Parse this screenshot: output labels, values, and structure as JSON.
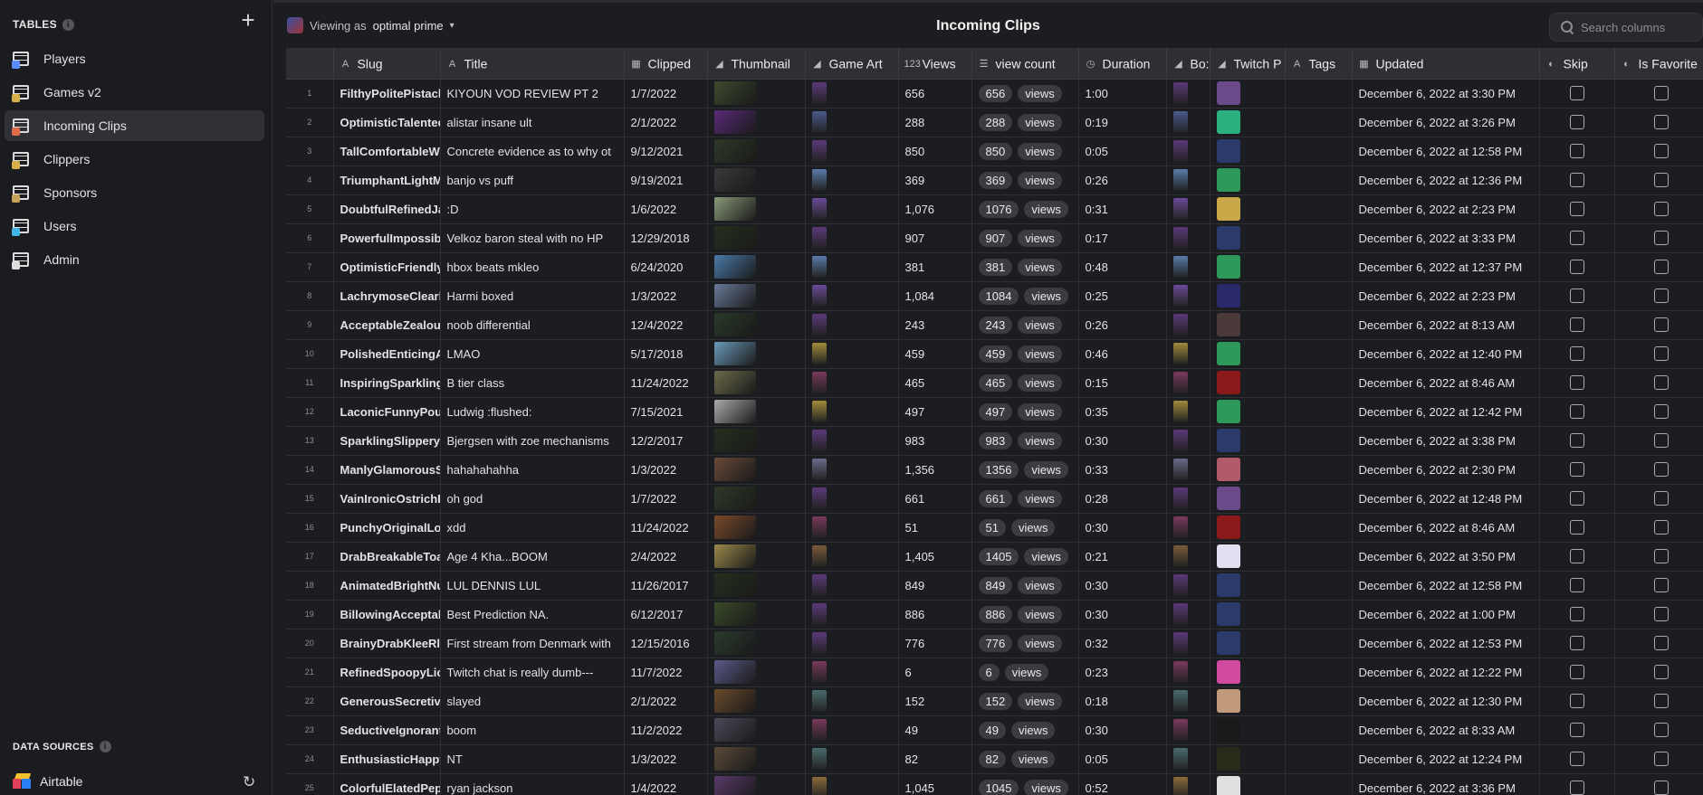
{
  "sidebar": {
    "section_title": "TABLES",
    "items": [
      {
        "label": "Players",
        "dot": "#5b8cff"
      },
      {
        "label": "Games v2",
        "dot": "#d7b04a"
      },
      {
        "label": "Incoming Clips",
        "dot": "#e06c4a"
      },
      {
        "label": "Clippers",
        "dot": "#d7b04a"
      },
      {
        "label": "Sponsors",
        "dot": "#c7a25b"
      },
      {
        "label": "Users",
        "dot": "#41b6e6"
      },
      {
        "label": "Admin",
        "dot": "#dddddd"
      }
    ],
    "active_index": 2,
    "data_sources_title": "DATA SOURCES",
    "data_source": "Airtable"
  },
  "topbar": {
    "viewing_prefix": "Viewing as",
    "viewing_user": "optimal prime",
    "title": "Incoming Clips",
    "search_placeholder": "Search columns"
  },
  "columns": [
    {
      "key": "num",
      "label": "",
      "icon": ""
    },
    {
      "key": "slug",
      "label": "Slug",
      "icon": "A"
    },
    {
      "key": "title",
      "label": "Title",
      "icon": "A"
    },
    {
      "key": "clipped",
      "label": "Clipped",
      "icon": "▦"
    },
    {
      "key": "thumb",
      "label": "Thumbnail",
      "icon": "◢"
    },
    {
      "key": "art",
      "label": "Game Art",
      "icon": "◢"
    },
    {
      "key": "views",
      "label": "Views",
      "icon": "123"
    },
    {
      "key": "vc",
      "label": "view count",
      "icon": "☰"
    },
    {
      "key": "dur",
      "label": "Duration",
      "icon": "◷"
    },
    {
      "key": "box",
      "label": "Bo:",
      "icon": "◢"
    },
    {
      "key": "twitch",
      "label": "Twitch P",
      "icon": "◢"
    },
    {
      "key": "tags",
      "label": "Tags",
      "icon": "A"
    },
    {
      "key": "updated",
      "label": "Updated",
      "icon": "▦"
    },
    {
      "key": "skip",
      "label": "Skip",
      "icon": "◐"
    },
    {
      "key": "fav",
      "label": "Is Favorite",
      "icon": "◐"
    }
  ],
  "views_unit": "views",
  "rows": [
    {
      "n": "1",
      "slug": "FilthyPolitePistach",
      "title": "KIYOUN VOD REVIEW PT 2",
      "clipped": "1/7/2022",
      "views": "656",
      "vc": "656",
      "dur": "1:00",
      "updated": "December 6, 2022 at 3:30 PM",
      "thumb": "#3d4a2e",
      "art": "#5a3a7a",
      "twitch": "#6b4a8a"
    },
    {
      "n": "2",
      "slug": "OptimisticTalented",
      "title": "alistar insane ult",
      "clipped": "2/1/2022",
      "views": "288",
      "vc": "288",
      "dur": "0:19",
      "updated": "December 6, 2022 at 3:26 PM",
      "thumb": "#5a2a7a",
      "art": "#4a5a8a",
      "twitch": "#2bb080"
    },
    {
      "n": "3",
      "slug": "TallComfortableW",
      "title": "Concrete evidence as to why ot",
      "clipped": "9/12/2021",
      "views": "850",
      "vc": "850",
      "dur": "0:05",
      "updated": "December 6, 2022 at 12:58 PM",
      "thumb": "#2e3a28",
      "art": "#5a3a7a",
      "twitch": "#2a3a6a"
    },
    {
      "n": "4",
      "slug": "TriumphantLightM",
      "title": "banjo vs puff",
      "clipped": "9/19/2021",
      "views": "369",
      "vc": "369",
      "dur": "0:26",
      "updated": "December 6, 2022 at 12:36 PM",
      "thumb": "#3a3a3a",
      "art": "#5a7aaa",
      "twitch": "#2e9a5a"
    },
    {
      "n": "5",
      "slug": "DoubtfulRefinedJa",
      "title": ":D",
      "clipped": "1/6/2022",
      "views": "1,076",
      "vc": "1076",
      "dur": "0:31",
      "updated": "December 6, 2022 at 2:23 PM",
      "thumb": "#8a9a7a",
      "art": "#6a4a9a",
      "twitch": "#c9a84a"
    },
    {
      "n": "6",
      "slug": "PowerfulImpossib",
      "title": "Velkoz baron steal with no HP",
      "clipped": "12/29/2018",
      "views": "907",
      "vc": "907",
      "dur": "0:17",
      "updated": "December 6, 2022 at 3:33 PM",
      "thumb": "#26301e",
      "art": "#5a3a7a",
      "twitch": "#2a3a6a"
    },
    {
      "n": "7",
      "slug": "OptimisticFriendly",
      "title": "hbox beats mkleo",
      "clipped": "6/24/2020",
      "views": "381",
      "vc": "381",
      "dur": "0:48",
      "updated": "December 6, 2022 at 12:37 PM",
      "thumb": "#4a7aaa",
      "art": "#5a7aaa",
      "twitch": "#2e9a5a"
    },
    {
      "n": "8",
      "slug": "LachrymoseClearl",
      "title": "Harmi boxed",
      "clipped": "1/3/2022",
      "views": "1,084",
      "vc": "1084",
      "dur": "0:25",
      "updated": "December 6, 2022 at 2:23 PM",
      "thumb": "#6a7a9a",
      "art": "#6a4a9a",
      "twitch": "#2a2a6a"
    },
    {
      "n": "9",
      "slug": "AcceptableZealou",
      "title": "noob differential",
      "clipped": "12/4/2022",
      "views": "243",
      "vc": "243",
      "dur": "0:26",
      "updated": "December 6, 2022 at 8:13 AM",
      "thumb": "#2a3a2a",
      "art": "#5a3a7a",
      "twitch": "#4a3a3a"
    },
    {
      "n": "10",
      "slug": "PolishedEnticingA",
      "title": "LMAO",
      "clipped": "5/17/2018",
      "views": "459",
      "vc": "459",
      "dur": "0:46",
      "updated": "December 6, 2022 at 12:40 PM",
      "thumb": "#6a9aba",
      "art": "#a08a3a",
      "twitch": "#2e9a5a"
    },
    {
      "n": "11",
      "slug": "InspiringSparkling",
      "title": "B tier class",
      "clipped": "11/24/2022",
      "views": "465",
      "vc": "465",
      "dur": "0:15",
      "updated": "December 6, 2022 at 8:46 AM",
      "thumb": "#6a6a4a",
      "art": "#7a3a5a",
      "twitch": "#8a1a1a"
    },
    {
      "n": "12",
      "slug": "LaconicFunnyPoul",
      "title": "Ludwig :flushed:",
      "clipped": "7/15/2021",
      "views": "497",
      "vc": "497",
      "dur": "0:35",
      "updated": "December 6, 2022 at 12:42 PM",
      "thumb": "#aaaaaa",
      "art": "#a08a3a",
      "twitch": "#2e9a5a"
    },
    {
      "n": "13",
      "slug": "SparklingSlipperyI",
      "title": "Bjergsen with zoe mechanisms",
      "clipped": "12/2/2017",
      "views": "983",
      "vc": "983",
      "dur": "0:30",
      "updated": "December 6, 2022 at 3:38 PM",
      "thumb": "#26301e",
      "art": "#5a3a7a",
      "twitch": "#2a3a6a"
    },
    {
      "n": "14",
      "slug": "ManlyGlamorousS",
      "title": "hahahahahha",
      "clipped": "1/3/2022",
      "views": "1,356",
      "vc": "1356",
      "dur": "0:33",
      "updated": "December 6, 2022 at 2:30 PM",
      "thumb": "#6a4a3a",
      "art": "#6a6a8a",
      "twitch": "#b05a6a"
    },
    {
      "n": "15",
      "slug": "VainIronicOstrichE",
      "title": "oh god",
      "clipped": "1/7/2022",
      "views": "661",
      "vc": "661",
      "dur": "0:28",
      "updated": "December 6, 2022 at 12:48 PM",
      "thumb": "#2e3a28",
      "art": "#5a3a7a",
      "twitch": "#6b4a8a"
    },
    {
      "n": "16",
      "slug": "PunchyOriginalLoi",
      "title": "xdd",
      "clipped": "11/24/2022",
      "views": "51",
      "vc": "51",
      "dur": "0:30",
      "updated": "December 6, 2022 at 8:46 AM",
      "thumb": "#7a4a2a",
      "art": "#7a3a5a",
      "twitch": "#8a1a1a"
    },
    {
      "n": "17",
      "slug": "DrabBreakableToa",
      "title": "Age 4 Kha...BOOM",
      "clipped": "2/4/2022",
      "views": "1,405",
      "vc": "1405",
      "dur": "0:21",
      "updated": "December 6, 2022 at 3:50 PM",
      "thumb": "#9a8a4a",
      "art": "#7a5a3a",
      "twitch": "#e0e0f0"
    },
    {
      "n": "18",
      "slug": "AnimatedBrightNu",
      "title": "LUL DENNIS LUL",
      "clipped": "11/26/2017",
      "views": "849",
      "vc": "849",
      "dur": "0:30",
      "updated": "December 6, 2022 at 12:58 PM",
      "thumb": "#26301e",
      "art": "#5a3a7a",
      "twitch": "#2a3a6a"
    },
    {
      "n": "19",
      "slug": "BillowingAcceptab",
      "title": "Best Prediction NA.",
      "clipped": "6/12/2017",
      "views": "886",
      "vc": "886",
      "dur": "0:30",
      "updated": "December 6, 2022 at 1:00 PM",
      "thumb": "#3a4a2a",
      "art": "#5a3a7a",
      "twitch": "#2a3a6a"
    },
    {
      "n": "20",
      "slug": "BrainyDrabKleeRly",
      "title": "First stream from Denmark with",
      "clipped": "12/15/2016",
      "views": "776",
      "vc": "776",
      "dur": "0:32",
      "updated": "December 6, 2022 at 12:53 PM",
      "thumb": "#2a3a2e",
      "art": "#5a3a7a",
      "twitch": "#2a3a6a"
    },
    {
      "n": "21",
      "slug": "RefinedSpoopyLio",
      "title": "Twitch chat is really dumb---",
      "clipped": "11/7/2022",
      "views": "6",
      "vc": "6",
      "dur": "0:23",
      "updated": "December 6, 2022 at 12:22 PM",
      "thumb": "#5a5a8a",
      "art": "#7a3a5a",
      "twitch": "#d04aa0"
    },
    {
      "n": "22",
      "slug": "GenerousSecretiv",
      "title": "slayed",
      "clipped": "2/1/2022",
      "views": "152",
      "vc": "152",
      "dur": "0:18",
      "updated": "December 6, 2022 at 12:30 PM",
      "thumb": "#6a4a2a",
      "art": "#4a6a6a",
      "twitch": "#c09a7a"
    },
    {
      "n": "23",
      "slug": "SeductiveIgnorant",
      "title": "boom",
      "clipped": "11/2/2022",
      "views": "49",
      "vc": "49",
      "dur": "0:30",
      "updated": "December 6, 2022 at 8:33 AM",
      "thumb": "#4a4a5a",
      "art": "#7a3a5a",
      "twitch": "#1a1a1a"
    },
    {
      "n": "24",
      "slug": "EnthusiasticHappy",
      "title": "NT",
      "clipped": "1/3/2022",
      "views": "82",
      "vc": "82",
      "dur": "0:05",
      "updated": "December 6, 2022 at 12:24 PM",
      "thumb": "#5a4a3a",
      "art": "#4a6a6a",
      "twitch": "#2a2a1a"
    },
    {
      "n": "25",
      "slug": "ColorfulElatedPep",
      "title": "ryan jackson",
      "clipped": "1/4/2022",
      "views": "1,045",
      "vc": "1045",
      "dur": "0:52",
      "updated": "December 6, 2022 at 3:36 PM",
      "thumb": "#5a3a6a",
      "art": "#8a6a3a",
      "twitch": "#e0e0e0"
    }
  ]
}
